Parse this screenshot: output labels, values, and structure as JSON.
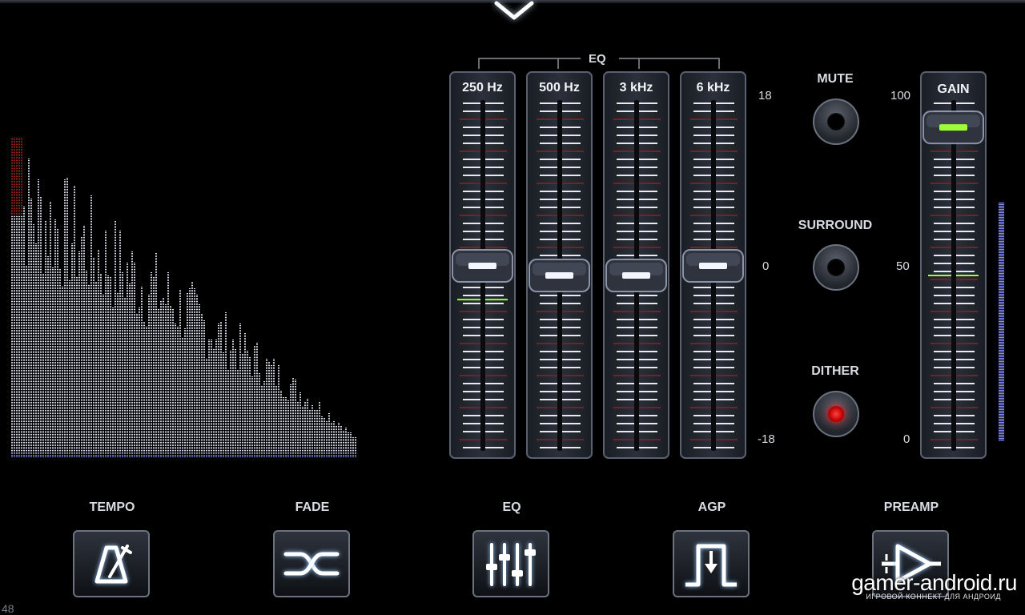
{
  "eq_group_label": "EQ",
  "faders": [
    {
      "label": "250 Hz",
      "value_db": 1
    },
    {
      "label": "500 Hz",
      "value_db": 0
    },
    {
      "label": "3 kHz",
      "value_db": 0
    },
    {
      "label": "6 kHz",
      "value_db": 1
    }
  ],
  "eq_scale": {
    "top": "18",
    "mid": "0",
    "bottom": "-18"
  },
  "toggles": [
    {
      "label": "MUTE",
      "icon": "mute-icon",
      "on": false
    },
    {
      "label": "SURROUND",
      "icon": "surround-icon",
      "on": false
    },
    {
      "label": "DITHER",
      "icon": "dither-icon",
      "on": true
    }
  ],
  "gain": {
    "label": "GAIN",
    "value": 93,
    "scale_top": "100",
    "scale_mid": "50",
    "scale_bottom": "0"
  },
  "bottom_buttons": [
    {
      "label": "TEMPO",
      "icon": "metronome-icon"
    },
    {
      "label": "FADE",
      "icon": "crossfade-icon"
    },
    {
      "label": "EQ",
      "icon": "eq-sliders-icon"
    },
    {
      "label": "AGP",
      "icon": "agp-gate-icon"
    },
    {
      "label": "PREAMP",
      "icon": "preamp-icon"
    }
  ],
  "watermark": "gamer-android.ru",
  "watermark_sub": "ИГРОВОЙ КОННЕКТ ДЛЯ АНДРОИД",
  "fps": "48",
  "colors": {
    "accent_green": "#9cff3a",
    "led_red": "#ff2020",
    "meter_blue": "#8a8fff",
    "clip_red": "#a02020"
  }
}
